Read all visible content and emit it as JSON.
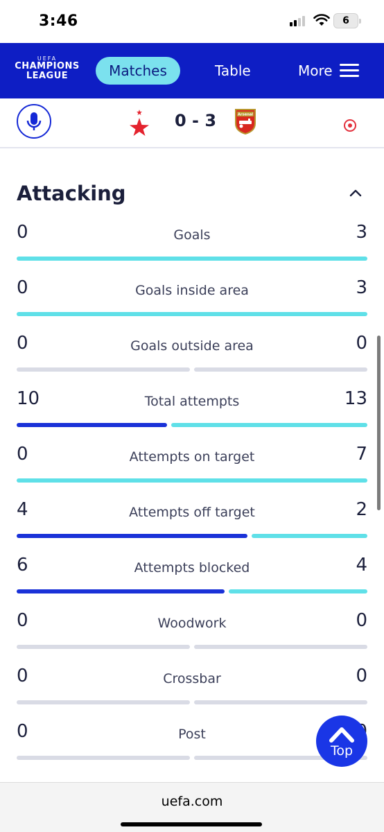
{
  "status_bar": {
    "time": "3:46",
    "battery": "6"
  },
  "nav": {
    "logo_top": "UEFA",
    "logo_line1": "CHAMPIONS",
    "logo_line2": "LEAGUE",
    "tabs": [
      {
        "label": "Matches",
        "active": true
      },
      {
        "label": "Table",
        "active": false
      },
      {
        "label": "More",
        "active": false
      }
    ]
  },
  "match": {
    "score": "0 - 3",
    "home_icon": "red-star-crest-icon",
    "away_icon": "arsenal-crest-icon",
    "away_crest_text": "Arsenal"
  },
  "section": {
    "title": "Attacking"
  },
  "colors": {
    "home_bar": "#1a32d8",
    "away_bar": "#5fe0e8",
    "empty_bar": "#d9dbe5",
    "nav_bg": "#0e1ec4"
  },
  "stats": [
    {
      "label": "Goals",
      "home": "0",
      "away": "3"
    },
    {
      "label": "Goals inside area",
      "home": "0",
      "away": "3"
    },
    {
      "label": "Goals outside area",
      "home": "0",
      "away": "0"
    },
    {
      "label": "Total attempts",
      "home": "10",
      "away": "13"
    },
    {
      "label": "Attempts on target",
      "home": "0",
      "away": "7"
    },
    {
      "label": "Attempts off target",
      "home": "4",
      "away": "2"
    },
    {
      "label": "Attempts blocked",
      "home": "6",
      "away": "4"
    },
    {
      "label": "Woodwork",
      "home": "0",
      "away": "0"
    },
    {
      "label": "Crossbar",
      "home": "0",
      "away": "0"
    },
    {
      "label": "Post",
      "home": "0",
      "away": "0"
    }
  ],
  "top_button": {
    "label": "Top"
  },
  "footer": {
    "url": "uefa.com"
  }
}
